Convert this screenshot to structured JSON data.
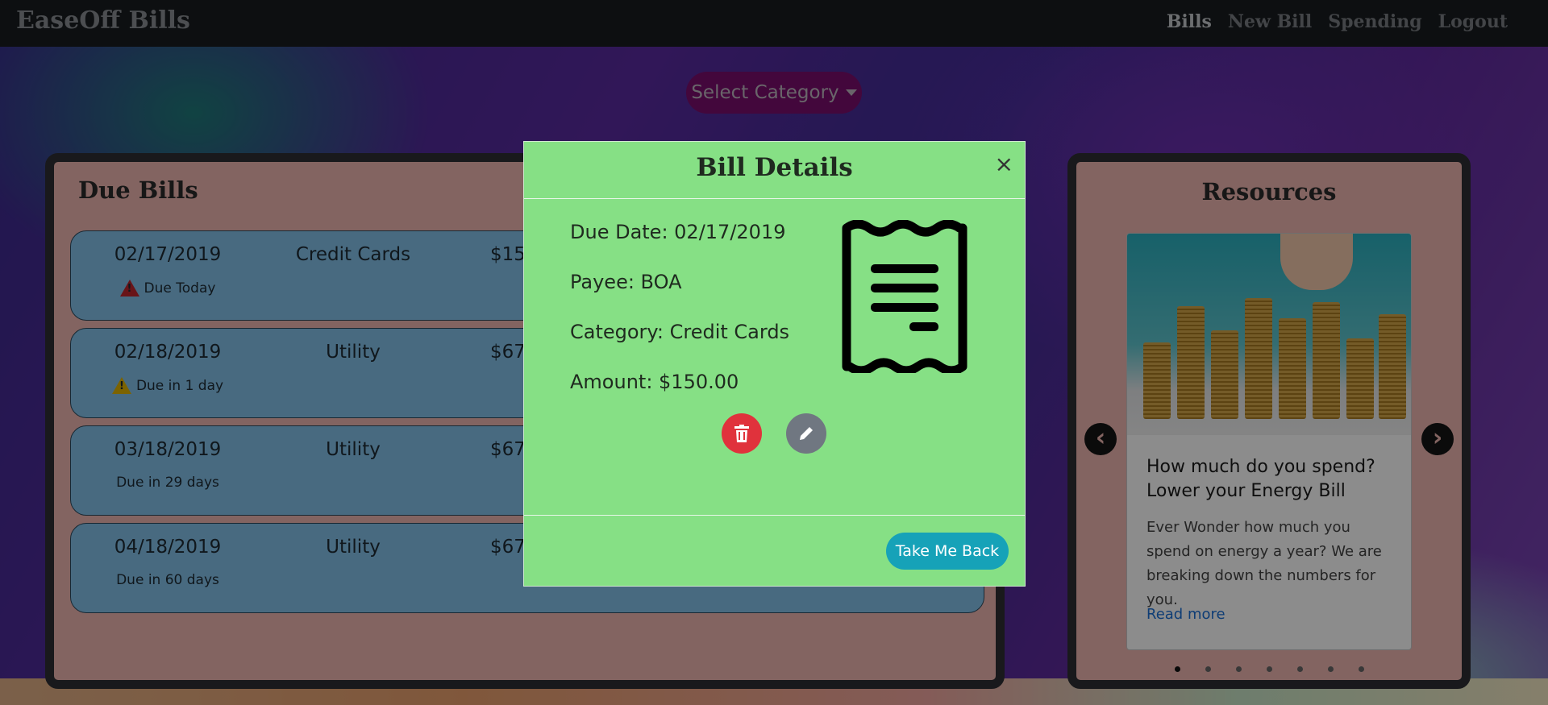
{
  "app": {
    "brand": "EaseOff Bills"
  },
  "nav": {
    "items": [
      "Bills",
      "New Bill",
      "Spending",
      "Logout"
    ],
    "active": "Bills"
  },
  "select_category": {
    "label": "Select Category"
  },
  "due_bills": {
    "title": "Due Bills",
    "items": [
      {
        "date": "02/17/2019",
        "category": "Credit Cards",
        "amount": "$150",
        "status": "Due Today",
        "alert": "red"
      },
      {
        "date": "02/18/2019",
        "category": "Utility",
        "amount": "$67",
        "status": "Due in 1 day",
        "alert": "yellow"
      },
      {
        "date": "03/18/2019",
        "category": "Utility",
        "amount": "$67",
        "status": "Due in 29 days",
        "alert": "none"
      },
      {
        "date": "04/18/2019",
        "category": "Utility",
        "amount": "$67",
        "status": "Due in 60 days",
        "alert": "none"
      }
    ]
  },
  "resources": {
    "title": "Resources",
    "card": {
      "heading": "How much do you spend? Lower your Energy Bill",
      "text": "Ever Wonder how much you spend on energy a year? We are breaking down the numbers for you.",
      "link": "Read more"
    },
    "carousel_slides": 7,
    "active_slide": 1
  },
  "modal": {
    "title": "Bill Details",
    "close": "×",
    "due_date": "Due Date: 02/17/2019",
    "payee": "Payee: BOA",
    "category": "Category: Credit Cards",
    "amount": "Amount: $150.00",
    "back_button": "Take Me Back"
  },
  "colors": {
    "modal_bg": "#86e085",
    "bill_card": "#83c1e9",
    "panel_bg": "#eeb7b1",
    "delete": "#e0323c",
    "edit": "#707781",
    "back_button": "#16a2b8"
  }
}
